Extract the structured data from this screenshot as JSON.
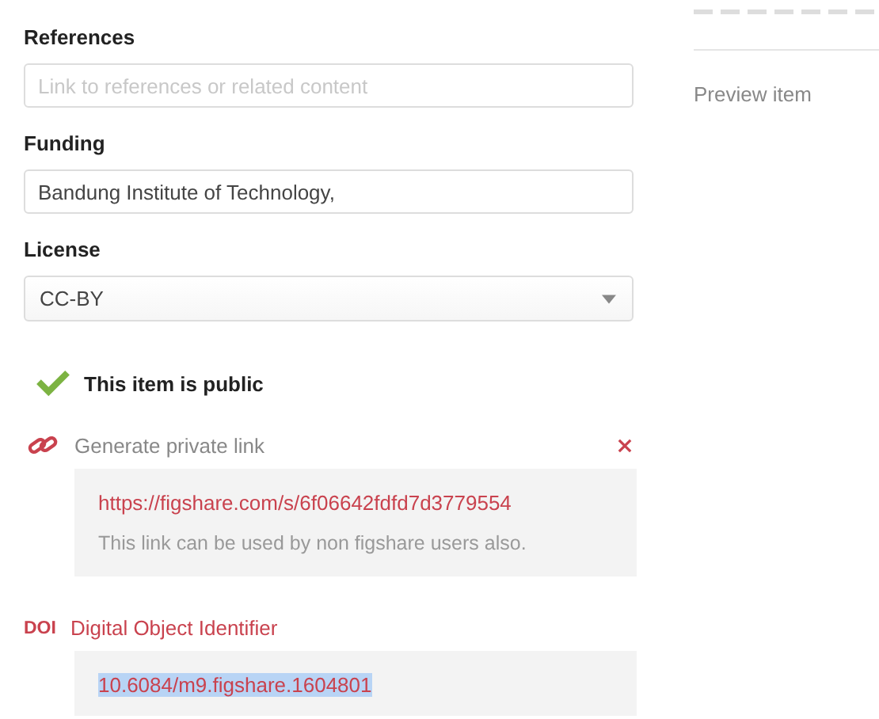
{
  "fields": [
    {
      "kind": "text",
      "label": "References",
      "placeholder": "Link to references or related content"
    },
    {
      "kind": "text",
      "label": "Funding",
      "value": "Bandung Institute of Technology,"
    },
    {
      "kind": "select",
      "label": "License",
      "value": "CC-BY"
    }
  ],
  "visibility": {
    "public": true,
    "label": "This item is public"
  },
  "private_link": {
    "label": "Generate private link",
    "url": "https://figshare.com/s/6f06642fdfd7d3779554",
    "note": "This link can be used by non figshare users also."
  },
  "doi": {
    "badge": "DOI",
    "label": "Digital Object Identifier",
    "value": "10.6084/m9.figshare.1604801",
    "highlighted": true
  },
  "sidebar": {
    "link": "Preview item"
  }
}
